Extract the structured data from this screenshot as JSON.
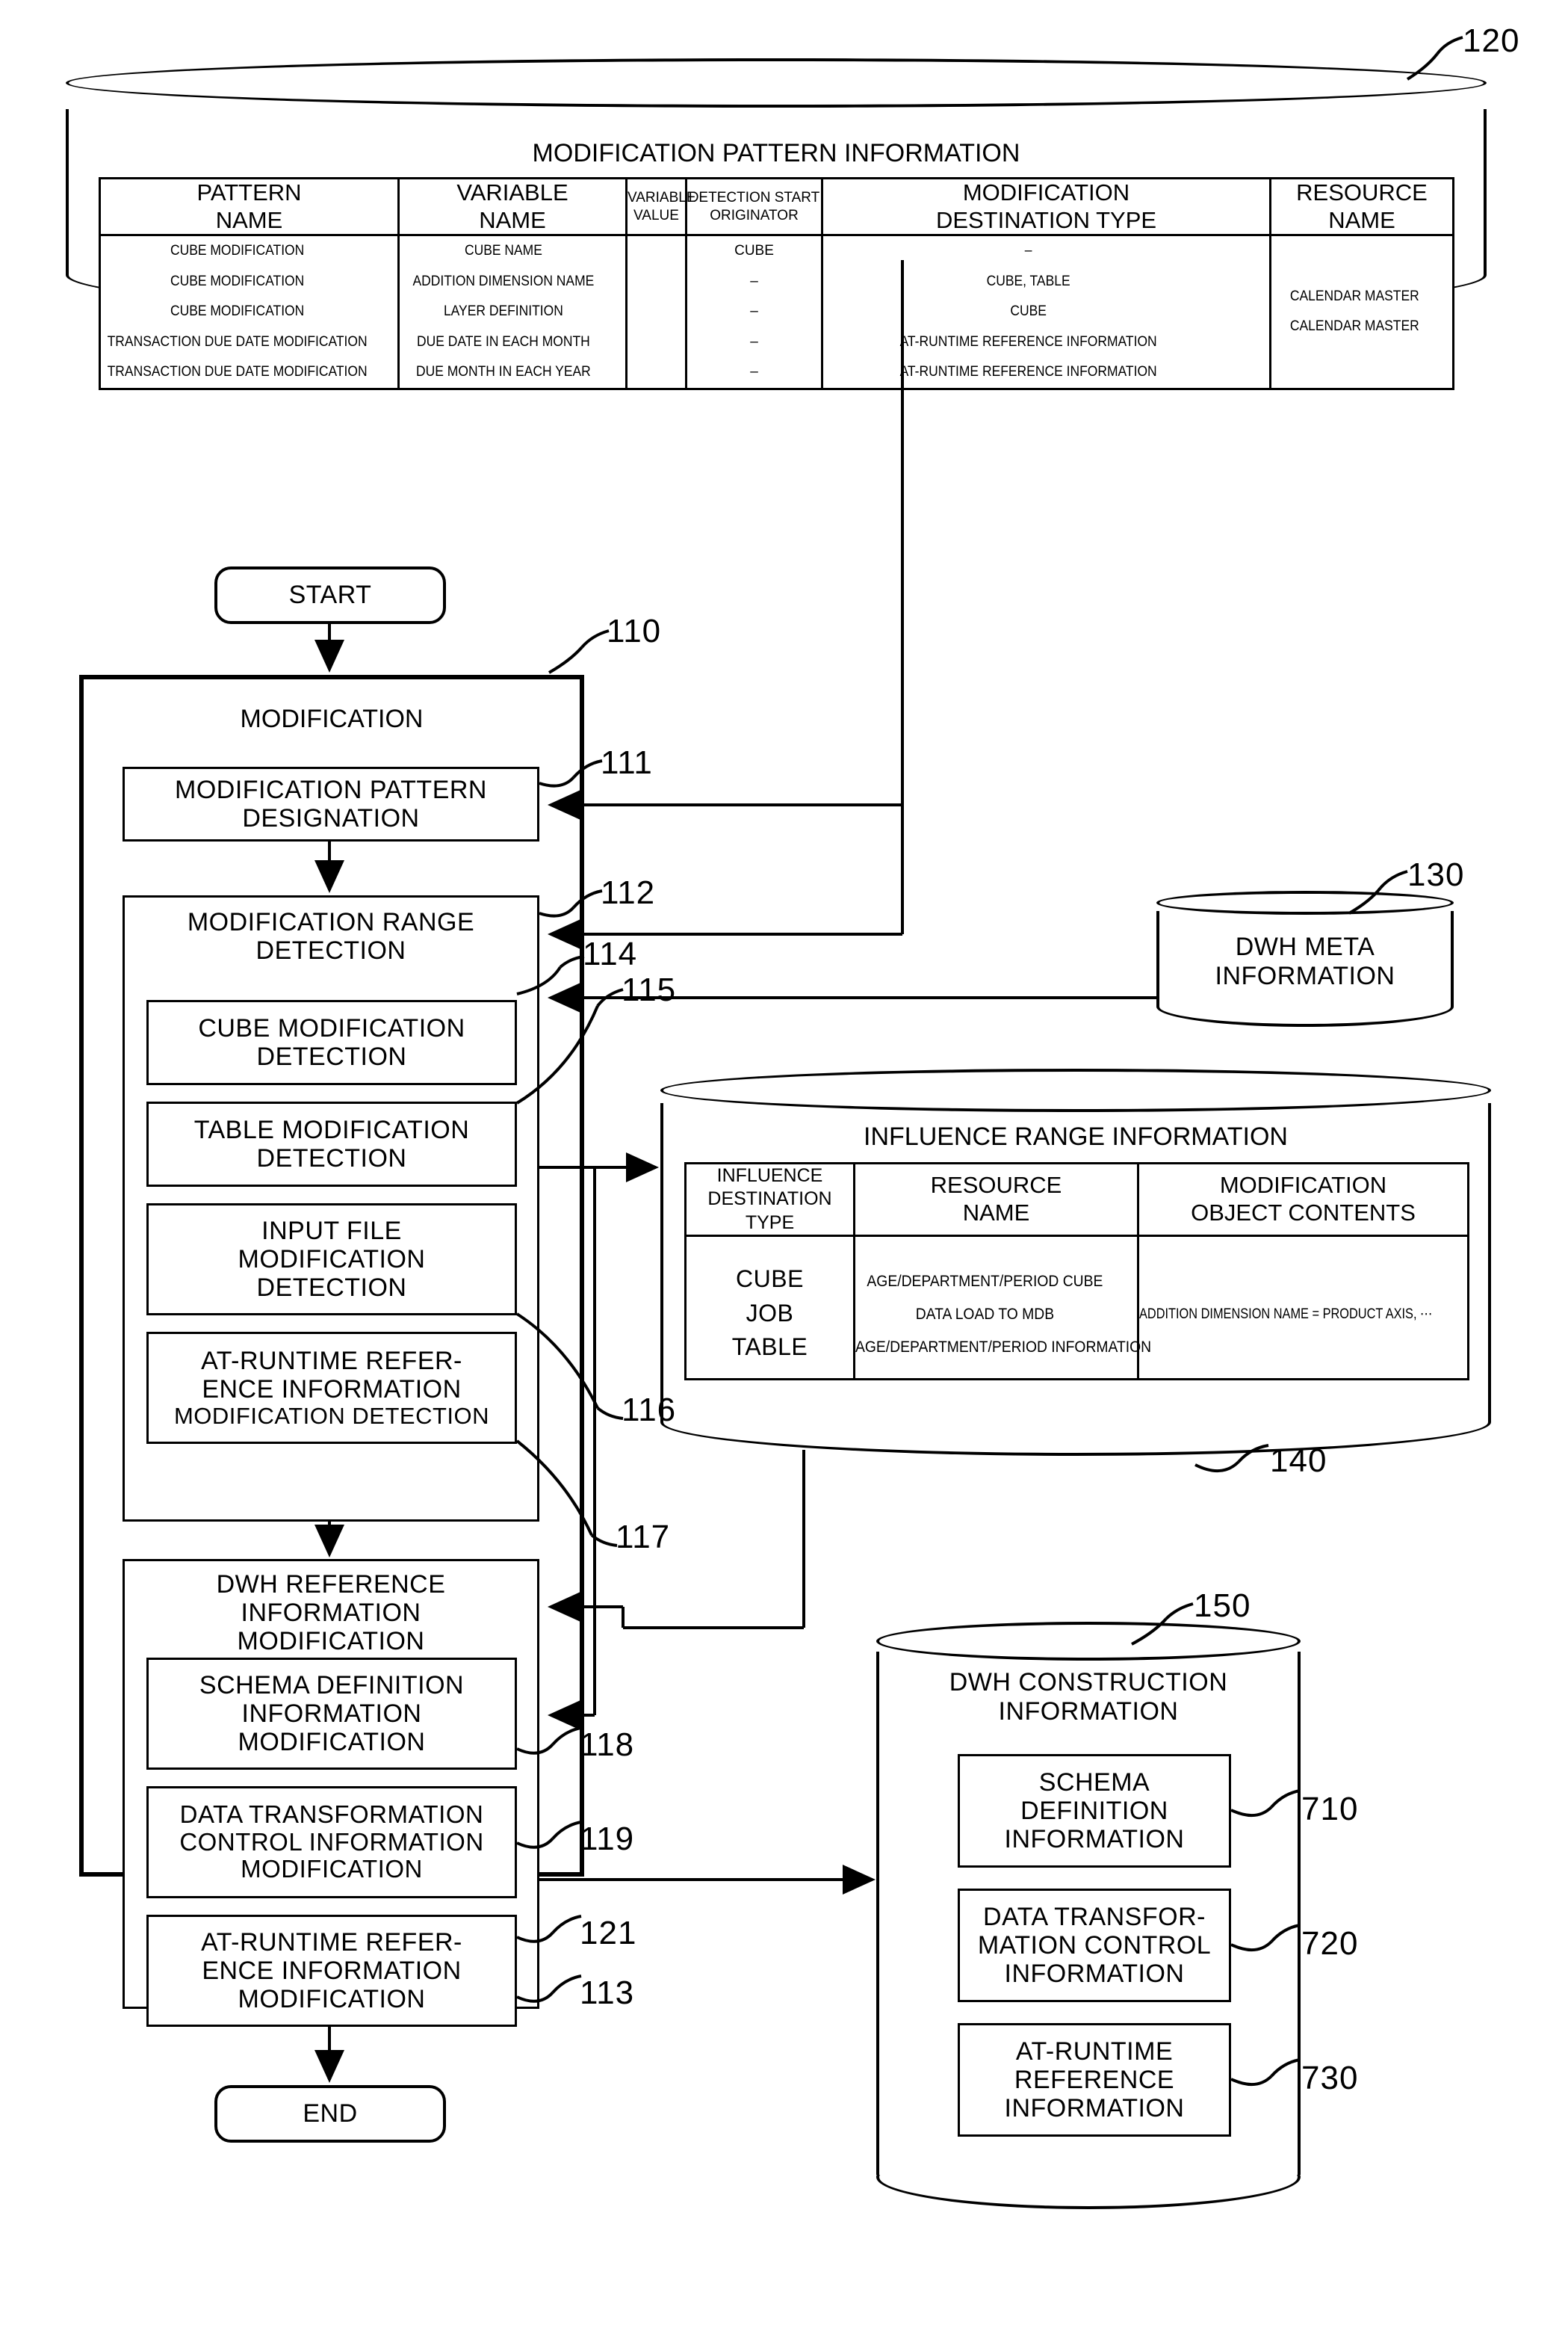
{
  "figure": {
    "modification_pattern_db": {
      "ref": "120",
      "title": "MODIFICATION PATTERN INFORMATION",
      "columns": [
        "PATTERN\nNAME",
        "VARIABLE\nNAME",
        "VARIABLE\nVALUE",
        "DETECTION START\nORIGINATOR",
        "MODIFICATION\nDESTINATION TYPE",
        "RESOURCE\nNAME"
      ],
      "column_lines": [
        [
          "PATTERN",
          "NAME"
        ],
        [
          "VARIABLE",
          "NAME"
        ],
        [
          "VARIABLE",
          "VALUE"
        ],
        [
          "DETECTION START",
          "ORIGINATOR"
        ],
        [
          "MODIFICATION",
          "DESTINATION TYPE"
        ],
        [
          "RESOURCE",
          "NAME"
        ]
      ],
      "rows": [
        [
          "CUBE MODIFICATION",
          "CUBE NAME",
          "",
          "CUBE",
          "–",
          ""
        ],
        [
          "CUBE MODIFICATION",
          "ADDITION DIMENSION NAME",
          "",
          "–",
          "CUBE, TABLE",
          ""
        ],
        [
          "CUBE MODIFICATION",
          "LAYER DEFINITION",
          "",
          "–",
          "CUBE",
          ""
        ],
        [
          "TRANSACTION DUE DATE MODIFICATION",
          "DUE DATE IN EACH MONTH",
          "",
          "–",
          "AT-RUNTIME REFERENCE INFORMATION",
          "CALENDAR MASTER"
        ],
        [
          "TRANSACTION DUE DATE MODIFICATION",
          "DUE MONTH IN EACH YEAR",
          "",
          "–",
          "AT-RUNTIME REFERENCE INFORMATION",
          "CALENDAR MASTER"
        ]
      ]
    },
    "start_node": "START",
    "end_node": "END",
    "modification_process": {
      "ref": "110",
      "title": "MODIFICATION",
      "steps": [
        {
          "ref": "111",
          "lines": [
            "MODIFICATION PATTERN",
            "DESIGNATION"
          ]
        },
        {
          "ref": "112",
          "lines": [
            "MODIFICATION RANGE",
            "DETECTION"
          ]
        },
        {
          "ref": "114",
          "lines": [
            "CUBE MODIFICATION",
            "DETECTION"
          ]
        },
        {
          "ref": "115",
          "lines": [
            "TABLE MODIFICATION",
            "DETECTION"
          ]
        },
        {
          "ref": "116",
          "lines": [
            "INPUT FILE",
            "MODIFICATION",
            "DETECTION"
          ]
        },
        {
          "ref": "117",
          "lines": [
            "AT-RUNTIME REFER-",
            "ENCE INFORMATION",
            "MODIFICATION DETECTION"
          ]
        },
        {
          "ref": "113",
          "lines": [
            "DWH REFERENCE",
            "INFORMATION",
            "MODIFICATION"
          ]
        },
        {
          "ref": "118",
          "lines": [
            "SCHEMA DEFINITION",
            "INFORMATION",
            "MODIFICATION"
          ]
        },
        {
          "ref": "119",
          "lines": [
            "DATA TRANSFORMATION",
            "CONTROL INFORMATION",
            "MODIFICATION"
          ]
        },
        {
          "ref": "121",
          "lines": [
            "AT-RUNTIME REFER-",
            "ENCE INFORMATION",
            "MODIFICATION"
          ]
        }
      ]
    },
    "dwh_meta_db": {
      "ref": "130",
      "lines": [
        "DWH META",
        "INFORMATION"
      ]
    },
    "influence_range_db": {
      "ref": "140",
      "title": "INFLUENCE RANGE INFORMATION",
      "column_lines": [
        [
          "INFLUENCE",
          "DESTINATION TYPE"
        ],
        [
          "RESOURCE",
          "NAME"
        ],
        [
          "MODIFICATION",
          "OBJECT CONTENTS"
        ]
      ],
      "rows": [
        [
          "CUBE",
          "AGE/DEPARTMENT/PERIOD CUBE",
          "ADDITION DIMENSION NAME = PRODUCT AXIS, ⋯"
        ],
        [
          "JOB",
          "DATA LOAD TO MDB",
          ""
        ],
        [
          "TABLE",
          "AGE/DEPARTMENT/PERIOD INFORMATION",
          ""
        ]
      ]
    },
    "dwh_construction_db": {
      "ref": "150",
      "title_lines": [
        "DWH CONSTRUCTION",
        "INFORMATION"
      ],
      "items": [
        {
          "ref": "710",
          "lines": [
            "SCHEMA",
            "DEFINITION",
            "INFORMATION"
          ]
        },
        {
          "ref": "720",
          "lines": [
            "DATA TRANSFOR-",
            "MATION CONTROL",
            "INFORMATION"
          ]
        },
        {
          "ref": "730",
          "lines": [
            "AT-RUNTIME",
            "REFERENCE",
            "INFORMATION"
          ]
        }
      ]
    }
  }
}
